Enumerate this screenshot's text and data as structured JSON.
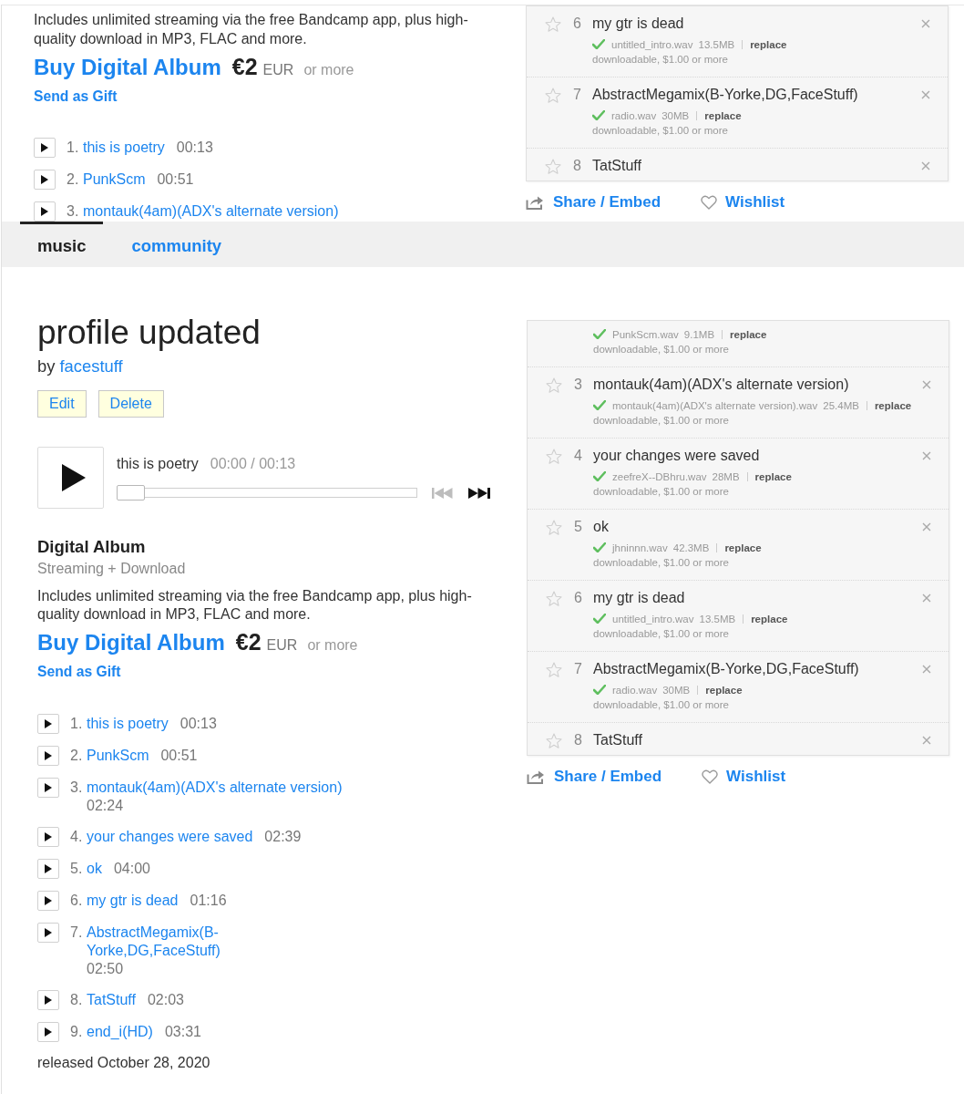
{
  "top_fragment": {
    "description": "Includes unlimited streaming via the free Bandcamp app, plus high-quality download in MP3, FLAC and more.",
    "buy": {
      "label": "Buy Digital Album",
      "price": "€2",
      "currency": "EUR",
      "suffix": "or more"
    },
    "gift_link": "Send as Gift",
    "tracks": [
      {
        "number": "1.",
        "title": "this is poetry",
        "duration": "00:13"
      },
      {
        "number": "2.",
        "title": "PunkScm",
        "duration": "00:51"
      },
      {
        "number": "3.",
        "title": "montauk(4am)(ADX's alternate version)"
      }
    ],
    "track_editor": {
      "rows": [
        {
          "starred": false,
          "number": "6",
          "title": "my gtr is dead",
          "file": "untitled_intro.wav",
          "size": "13.5MB",
          "action": "replace",
          "pricing": "downloadable, $1.00 or more"
        },
        {
          "starred": false,
          "number": "7",
          "title": "AbstractMegamix(B-Yorke,DG,FaceStuff)",
          "file": "radio.wav",
          "size": "30MB",
          "action": "replace",
          "pricing": "downloadable, $1.00 or more"
        },
        {
          "starred": false,
          "number": "8",
          "title": "TatStuff"
        }
      ]
    },
    "share_label": "Share / Embed",
    "wishlist_label": "Wishlist"
  },
  "nav": {
    "tabs": [
      {
        "label": "music",
        "selected": true
      },
      {
        "label": "community",
        "selected": false
      }
    ]
  },
  "album": {
    "title": "profile updated",
    "byline": "by",
    "artist": "facestuff",
    "buttons": [
      "Edit",
      "Delete"
    ],
    "player": {
      "track": "this is poetry",
      "time": "00:00 / 00:13",
      "level": 0,
      "controls": [
        {
          "kind": "previous",
          "disabled": true
        },
        {
          "kind": "next",
          "disabled": false
        }
      ]
    },
    "format": {
      "title": "Digital Album",
      "subtitle": "Streaming + Download"
    },
    "description": "Includes unlimited streaming via the free Bandcamp app, plus high-quality download in MP3, FLAC and more.",
    "buy": {
      "label": "Buy Digital Album",
      "price": "€2",
      "currency": "EUR",
      "suffix": "or more"
    },
    "gift_link": "Send as Gift",
    "tracks": [
      {
        "number": "1.",
        "title": "this is poetry",
        "duration": "00:13"
      },
      {
        "number": "2.",
        "title": "PunkScm",
        "duration": "00:51"
      },
      {
        "number": "3.",
        "title": "montauk(4am)(ADX's alternate version)",
        "duration": "02:24"
      },
      {
        "number": "4.",
        "title": "your changes were saved",
        "duration": "02:39"
      },
      {
        "number": "5.",
        "title": "ok",
        "duration": "04:00"
      },
      {
        "number": "6.",
        "title": "my gtr is dead",
        "duration": "01:16"
      },
      {
        "number": "7.",
        "title": "AbstractMegamix(B-Yorke,DG,FaceStuff)",
        "duration": "02:50"
      },
      {
        "number": "8.",
        "title": "TatStuff",
        "duration": "02:03"
      },
      {
        "number": "9.",
        "title": "end_i(HD)",
        "duration": "03:31"
      }
    ],
    "released": "released October 28, 2020",
    "track_editor": {
      "rows": [
        {
          "file": "PunkScm.wav",
          "size": "9.1MB",
          "action": "replace",
          "pricing": "downloadable, $1.00 or more"
        },
        {
          "starred": false,
          "number": "3",
          "title": "montauk(4am)(ADX's alternate version)",
          "file": "montauk(4am)(ADX's alternate version).wav",
          "size": "25.4MB",
          "action": "replace",
          "pricing": "downloadable, $1.00 or more"
        },
        {
          "starred": false,
          "number": "4",
          "title": "your changes were saved",
          "file": "zeefreX--DBhru.wav",
          "size": "28MB",
          "action": "replace",
          "pricing": "downloadable, $1.00 or more"
        },
        {
          "starred": false,
          "number": "5",
          "title": "ok",
          "file": "jhninnn.wav",
          "size": "42.3MB",
          "action": "replace",
          "pricing": "downloadable, $1.00 or more"
        },
        {
          "starred": false,
          "number": "6",
          "title": "my gtr is dead",
          "file": "untitled_intro.wav",
          "size": "13.5MB",
          "action": "replace",
          "pricing": "downloadable, $1.00 or more"
        },
        {
          "starred": false,
          "number": "7",
          "title": "AbstractMegamix(B-Yorke,DG,FaceStuff)",
          "file": "radio.wav",
          "size": "30MB",
          "action": "replace",
          "pricing": "downloadable, $1.00 or more"
        },
        {
          "starred": false,
          "number": "8",
          "title": "TatStuff"
        }
      ]
    },
    "share_label": "Share / Embed",
    "wishlist_label": "Wishlist"
  }
}
